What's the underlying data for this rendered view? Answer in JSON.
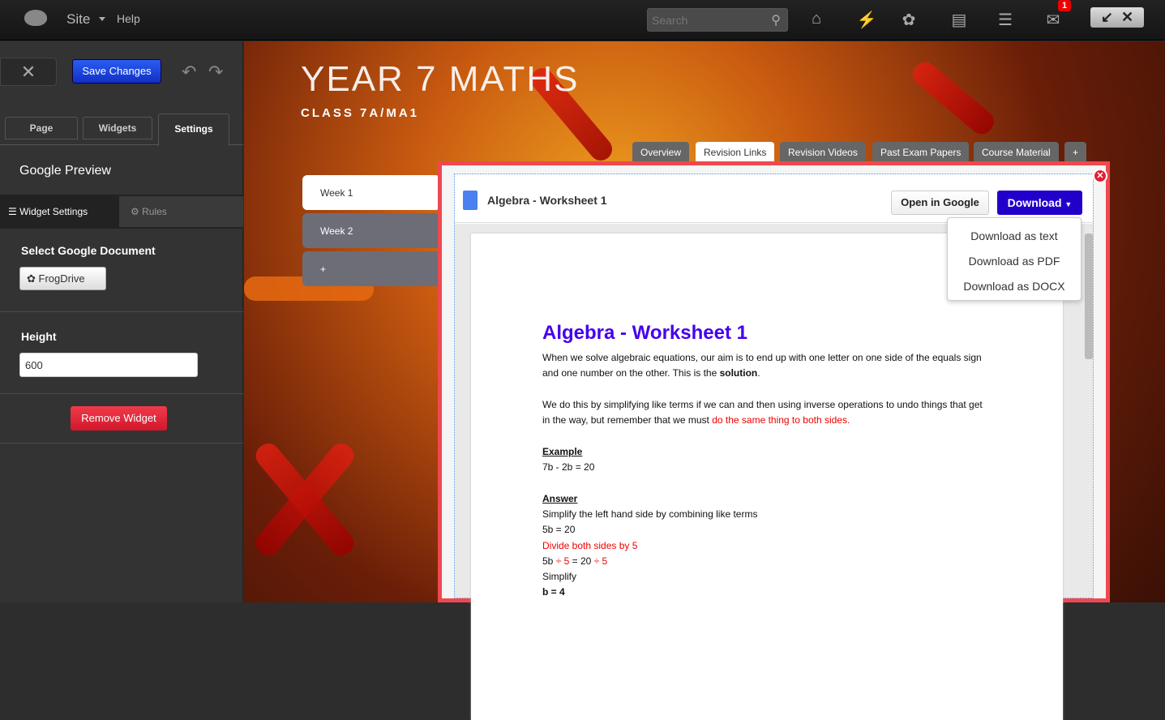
{
  "topbar": {
    "site": "Site",
    "help": "Help",
    "search_placeholder": "Search",
    "notification_count": "1",
    "icons": [
      "home-icon",
      "lightning-icon",
      "frogdrive-icon",
      "menu-dropdown-icon",
      "checklist-icon",
      "chat-icon"
    ]
  },
  "left_panel": {
    "save": "Save Changes",
    "tabs": [
      "Page",
      "Widgets",
      "Settings"
    ],
    "active_tab": "Settings",
    "widget_title": "Google Preview",
    "subtabs": [
      "Widget Settings",
      "Rules"
    ],
    "select_label": "Select Google Document",
    "frogdrive": "FrogDrive",
    "height_label": "Height",
    "height_value": "600",
    "remove": "Remove Widget"
  },
  "page": {
    "title": "YEAR 7 MATHS",
    "subtitle": "CLASS 7A/MA1",
    "tabs": [
      "Overview",
      "Revision Links",
      "Revision Videos",
      "Past Exam Papers",
      "Course Material",
      "+"
    ],
    "active_tab": "Revision Links",
    "weeks": [
      "Week 1",
      "Week 2",
      "+"
    ]
  },
  "widget": {
    "doc_title": "Algebra - Worksheet 1",
    "open_google": "Open in Google",
    "download": "Download",
    "download_menu": [
      "Download as text",
      "Download as PDF",
      "Download as DOCX"
    ],
    "doc": {
      "heading": "Algebra - Worksheet 1",
      "p1a": "When we solve algebraic equations, our aim is to end up with one letter on one side of the equals sign and one number on the other.  This is the ",
      "p1b": "solution",
      "p1c": ".",
      "p2a": "We do this by simplifying like terms if we can and then using inverse operations to undo things that get in the way, but remember that we must ",
      "p2b": "do the same thing to both sides.",
      "example": "Example",
      "eq1": "7b - 2b = 20",
      "answer": "Answer",
      "l1": "Simplify the left hand side by combining like terms",
      "l2": "5b = 20",
      "l3": "Divide both sides by 5",
      "l4a": "5b ",
      "l4b": "÷ 5",
      "l4c": " = 20 ",
      "l4d": "÷ 5",
      "l5": "Simplify",
      "l6": "b = 4"
    }
  },
  "colors": {
    "save": "#1a44e0",
    "download": "#2200cc",
    "remove": "#e0283a",
    "heading": "#4400ee",
    "highlight": "#ee0000",
    "widget_border": "#f04850"
  }
}
